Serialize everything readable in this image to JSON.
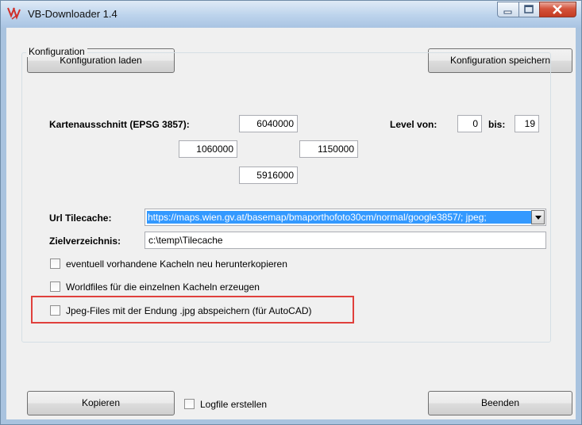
{
  "window": {
    "title": "VB-Downloader 1.4"
  },
  "toolbar": {
    "load_label": "Konfiguration laden",
    "save_label": "Konfiguration speichern"
  },
  "config": {
    "group_label": "Konfiguration",
    "extent_label": "Kartenausschnitt (EPSG 3857):",
    "north": "6040000",
    "west": "1060000",
    "east": "1150000",
    "south": "5916000",
    "level_from_label": "Level von:",
    "level_from": "0",
    "level_to_label": "bis:",
    "level_to": "19",
    "url_label": "Url Tilecache:",
    "url_value": "https://maps.wien.gv.at/basemap/bmaporthofoto30cm/normal/google3857/; jpeg;",
    "target_label": "Zielverzeichnis:",
    "target_value": "c:\\temp\\Tilecache",
    "option_redownload": "eventuell vorhandene Kacheln neu herunterkopieren",
    "option_worldfiles": "Worldfiles für die einzelnen Kacheln erzeugen",
    "option_jpg": "Jpeg-Files mit der Endung .jpg abspeichern (für AutoCAD)"
  },
  "footer": {
    "copy_label": "Kopieren",
    "logfile_label": "Logfile erstellen",
    "exit_label": "Beenden"
  },
  "colors": {
    "highlight": "#e0403c",
    "selection": "#3399ff",
    "titlebar": "#bcd3ec"
  }
}
